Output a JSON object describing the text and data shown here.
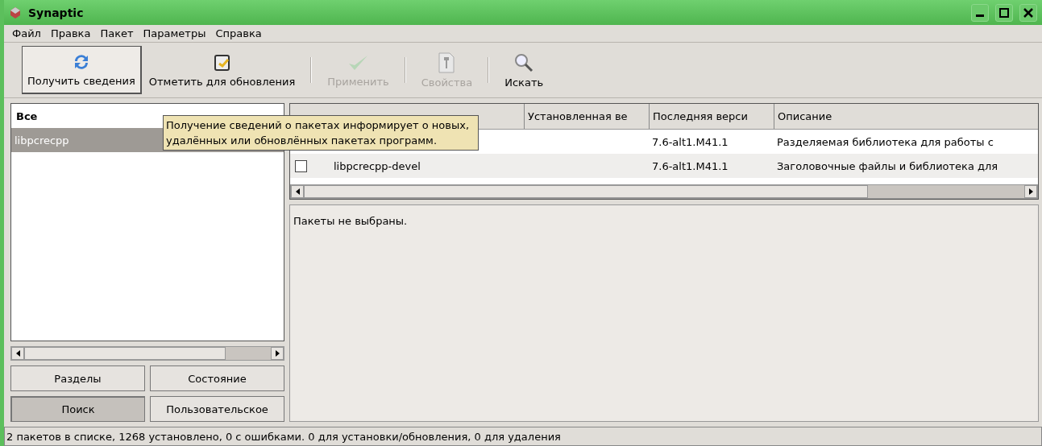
{
  "window": {
    "title": "Synaptic"
  },
  "menu": [
    "Файл",
    "Правка",
    "Пакет",
    "Параметры",
    "Справка"
  ],
  "toolbar": [
    {
      "label": "Получить сведения",
      "kind": "refresh",
      "disabled": false,
      "hovered": true
    },
    {
      "label": "Отметить для обновления",
      "kind": "mark",
      "disabled": false,
      "hovered": false
    },
    {
      "label": "Применить",
      "kind": "check",
      "disabled": true,
      "hovered": false
    },
    {
      "label": "Свойства",
      "kind": "props",
      "disabled": true,
      "hovered": false
    },
    {
      "label": "Искать",
      "kind": "search",
      "disabled": false,
      "hovered": false
    }
  ],
  "filters": {
    "header": "Все",
    "items": [
      {
        "label": "libpcrecpp",
        "selected": true
      }
    ]
  },
  "filter_buttons": [
    {
      "label": "Разделы",
      "selected": false
    },
    {
      "label": "Состояние",
      "selected": false
    },
    {
      "label": "Поиск",
      "selected": true
    },
    {
      "label": "Пользовательское",
      "selected": false
    }
  ],
  "table": {
    "columns": [
      "Установленная ве",
      "Последняя верси",
      "Описание"
    ],
    "rows": [
      {
        "latest": "7.6-alt1.M41.1",
        "description": "Разделяемая библиотека для работы с"
      },
      {
        "checked": false,
        "name": "libpcrecpp-devel",
        "latest": "7.6-alt1.M41.1",
        "description": "Заголовочные файлы и библиотека для"
      }
    ]
  },
  "details": "Пакеты не выбраны.",
  "tooltip": "Получение сведений о пакетах информирует о новых, удалённых или обновлённых пакетах программ.",
  "status_bar": "2 пакетов в списке, 1268 установлено, 0 с ошибками. 0 для установки/обновления, 0 для удаления"
}
